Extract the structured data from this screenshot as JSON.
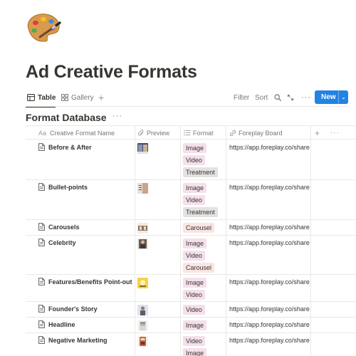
{
  "page": {
    "icon": "artist-palette-icon",
    "title": "Ad Creative Formats"
  },
  "views": {
    "tabs": [
      {
        "label": "Table",
        "icon": "table-icon",
        "active": true
      },
      {
        "label": "Gallery",
        "icon": "gallery-icon",
        "active": false
      }
    ],
    "add_symbol": "+"
  },
  "toolbar": {
    "filter_label": "Filter",
    "sort_label": "Sort",
    "search_icon": "search-icon",
    "expand_icon": "expand-arrows-icon",
    "more_symbol": "···",
    "new_label": "New",
    "new_menu_symbol": "⌄",
    "accent_color": "#2383e2"
  },
  "database": {
    "title": "Format Database",
    "more_symbol": "···",
    "columns": [
      {
        "label": "Creative Format Name",
        "icon": "text-aa-icon"
      },
      {
        "label": "Preview",
        "icon": "paperclip-icon"
      },
      {
        "label": "Format",
        "icon": "list-icon"
      },
      {
        "label": "Foreplay Board",
        "icon": "link-icon"
      }
    ],
    "add_column_symbol": "+",
    "column_more_symbol": "···",
    "tag_colors": {
      "Image": "#f4dfeb",
      "Video": "#f4dfeb",
      "Treatment": "#e3e2e0",
      "Carousel": "#fbe4e4"
    },
    "rows": [
      {
        "name": "Before & After",
        "preview": "thumb-before-after",
        "tags": [
          "Image",
          "Video",
          "Treatment"
        ],
        "link": "https://app.foreplay.co/share"
      },
      {
        "name": "Bullet-points",
        "preview": "thumb-bullet-points",
        "tags": [
          "Image",
          "Video",
          "Treatment"
        ],
        "link": "https://app.foreplay.co/share"
      },
      {
        "name": "Carousels",
        "preview": "thumb-carousels",
        "tags": [
          "Carousel"
        ],
        "link": "https://app.foreplay.co/share"
      },
      {
        "name": "Celebrity",
        "preview": "thumb-celebrity",
        "tags": [
          "Image",
          "Video",
          "Carousel"
        ],
        "link": "https://app.foreplay.co/share"
      },
      {
        "name": "Features/Benefits Point-out",
        "preview": "thumb-features",
        "tags": [
          "Image",
          "Video"
        ],
        "link": "https://app.foreplay.co/share"
      },
      {
        "name": "Founder's Story",
        "preview": "thumb-founder",
        "tags": [
          "Video"
        ],
        "link": "https://app.foreplay.co/share"
      },
      {
        "name": "Headline",
        "preview": "thumb-headline",
        "tags": [
          "Image"
        ],
        "link": "https://app.foreplay.co/share"
      },
      {
        "name": "Negative Marketing",
        "preview": "thumb-negative",
        "tags": [
          "Video",
          "Image"
        ],
        "link": "https://app.foreplay.co/share"
      }
    ]
  }
}
